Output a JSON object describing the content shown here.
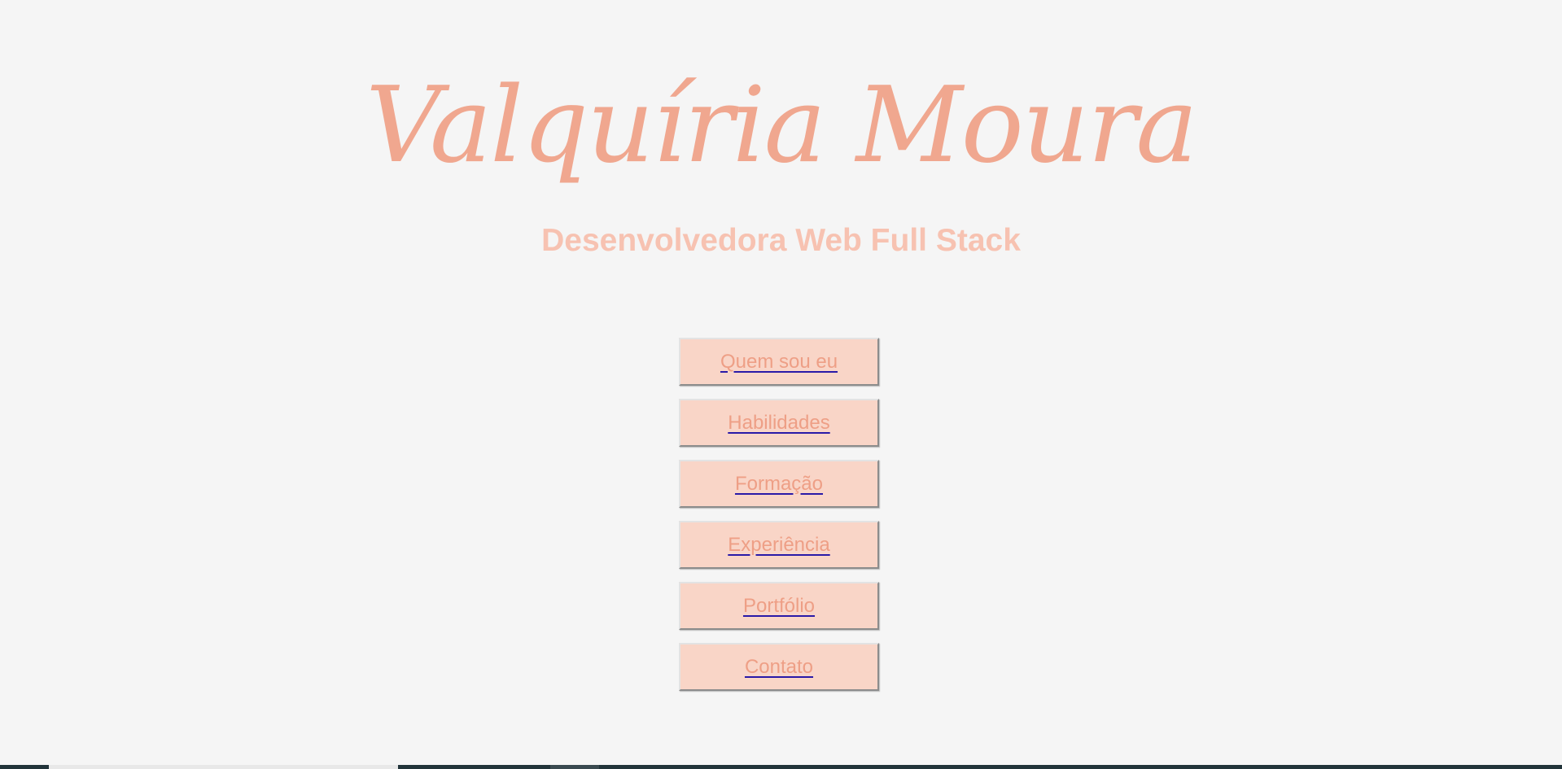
{
  "header": {
    "name": "Valquíria Moura",
    "subtitle": "Desenvolvedora Web Full Stack"
  },
  "nav": {
    "items": [
      {
        "label": "Quem sou eu"
      },
      {
        "label": "Habilidades"
      },
      {
        "label": "Formação"
      },
      {
        "label": "Experiência"
      },
      {
        "label": "Portfólio"
      },
      {
        "label": "Contato"
      }
    ]
  },
  "colors": {
    "background": "#f5f5f5",
    "name": "#f0a78f",
    "subtitle": "#f7c2b1",
    "button_bg": "#f9d5c7",
    "button_text": "#ee9f86",
    "link_underline": "#2a1aa8"
  }
}
